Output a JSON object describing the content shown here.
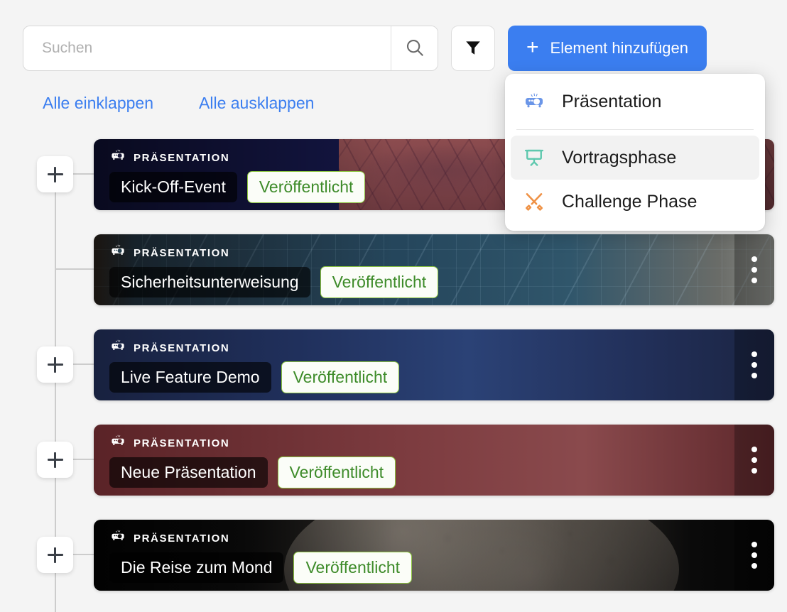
{
  "toolbar": {
    "search_placeholder": "Suchen",
    "search_value": "",
    "search_icon": "search-icon",
    "filter_icon": "filter-funnel-icon",
    "add_button_label": "Element hinzufügen",
    "add_button_plus": "+",
    "accent_color": "#3b7ef0"
  },
  "links": {
    "collapse_all": "Alle einklappen",
    "expand_all": "Alle ausklappen",
    "link_color": "#3b7ef0"
  },
  "dropdown": {
    "items": [
      {
        "label": "Präsentation",
        "icon": "projector-icon",
        "icon_color": "#6b96e8",
        "highlighted": false
      },
      {
        "label": "Vortragsphase",
        "icon": "presentation-board-icon",
        "icon_color": "#5ec8ae",
        "highlighted": true
      },
      {
        "label": "Challenge Phase",
        "icon": "crossed-swords-icon",
        "icon_color": "#ef9246",
        "highlighted": false
      }
    ]
  },
  "tree": {
    "plus_label": "+",
    "rows": [
      {
        "title": "Kick-Off-Event",
        "kicker": "PRÄSENTATION",
        "status": "Veröffentlicht",
        "has_plus": true,
        "has_menu": true
      },
      {
        "title": "Sicherheitsunterweisung",
        "kicker": "PRÄSENTATION",
        "status": "Veröffentlicht",
        "has_plus": false,
        "has_menu": true
      },
      {
        "title": "Live Feature Demo",
        "kicker": "PRÄSENTATION",
        "status": "Veröffentlicht",
        "has_plus": true,
        "has_menu": true
      },
      {
        "title": "Neue Präsentation",
        "kicker": "PRÄSENTATION",
        "status": "Veröffentlicht",
        "has_plus": true,
        "has_menu": true
      },
      {
        "title": "Die Reise zum Mond",
        "kicker": "PRÄSENTATION",
        "status": "Veröffentlicht",
        "has_plus": true,
        "has_menu": true
      }
    ],
    "status_text_color": "#3d8b29",
    "status_border_color": "#8cc63f"
  }
}
